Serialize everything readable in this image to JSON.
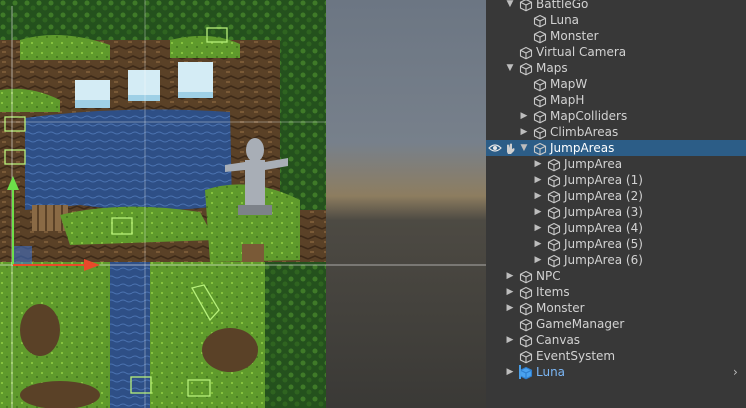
{
  "hierarchy": {
    "items": [
      {
        "label": "BattleGo",
        "expanded": true,
        "icon": "gameobject-cube-icon"
      },
      {
        "label": "Luna",
        "icon": "gameobject-cube-icon"
      },
      {
        "label": "Monster",
        "icon": "gameobject-cube-icon"
      },
      {
        "label": "Virtual Camera",
        "icon": "gameobject-cube-icon"
      },
      {
        "label": "Maps",
        "expanded": true,
        "icon": "gameobject-cube-icon"
      },
      {
        "label": "MapW",
        "icon": "gameobject-cube-icon"
      },
      {
        "label": "MapH",
        "icon": "gameobject-cube-icon"
      },
      {
        "label": "MapColliders",
        "expanded": false,
        "icon": "gameobject-cube-icon"
      },
      {
        "label": "ClimbAreas",
        "expanded": false,
        "icon": "gameobject-cube-icon"
      },
      {
        "label": "JumpAreas",
        "expanded": true,
        "selected": true,
        "icon": "gameobject-cube-icon"
      },
      {
        "label": "JumpArea",
        "expanded": false,
        "icon": "gameobject-cube-icon"
      },
      {
        "label": "JumpArea (1)",
        "expanded": false,
        "icon": "gameobject-cube-icon"
      },
      {
        "label": "JumpArea (2)",
        "expanded": false,
        "icon": "gameobject-cube-icon"
      },
      {
        "label": "JumpArea (3)",
        "expanded": false,
        "icon": "gameobject-cube-icon"
      },
      {
        "label": "JumpArea (4)",
        "expanded": false,
        "icon": "gameobject-cube-icon"
      },
      {
        "label": "JumpArea (5)",
        "expanded": false,
        "icon": "gameobject-cube-icon"
      },
      {
        "label": "JumpArea (6)",
        "expanded": false,
        "icon": "gameobject-cube-icon"
      },
      {
        "label": "NPC",
        "expanded": false,
        "icon": "gameobject-cube-icon"
      },
      {
        "label": "Items",
        "expanded": false,
        "icon": "gameobject-cube-icon"
      },
      {
        "label": "Monster",
        "expanded": false,
        "icon": "gameobject-cube-icon"
      },
      {
        "label": "GameManager",
        "icon": "gameobject-cube-icon"
      },
      {
        "label": "Canvas",
        "expanded": false,
        "icon": "gameobject-cube-icon"
      },
      {
        "label": "EventSystem",
        "icon": "gameobject-cube-icon"
      },
      {
        "label": "Luna",
        "expanded": false,
        "prefab": true,
        "icon": "prefab-cube-icon"
      }
    ]
  },
  "colors": {
    "panel": "#383838",
    "selection": "#2c5d87",
    "prefab_text": "#7bb6f5",
    "gizmo_green": "#b7f07a",
    "axis_y": "#6de04a",
    "axis_x": "#e84a2a"
  },
  "icons": {
    "visibility": "eye-icon",
    "pickable": "hand-pick-icon",
    "more": "chevron-right-icon"
  }
}
